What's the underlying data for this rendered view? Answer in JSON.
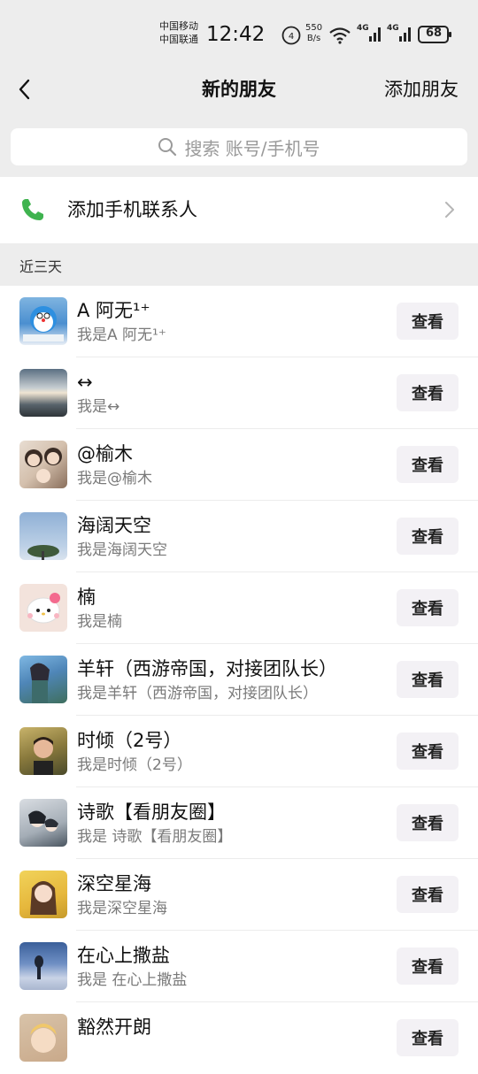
{
  "status_bar": {
    "carrier_1": "中国移动",
    "carrier_2": "中国联通",
    "time": "12:42",
    "net_speed_value": "550",
    "net_speed_unit": "B/s",
    "signal_label_1": "4G",
    "signal_label_2": "4G",
    "battery": "68"
  },
  "nav": {
    "title": "新的朋友",
    "action": "添加朋友"
  },
  "search": {
    "placeholder": "搜索 账号/手机号"
  },
  "add_contacts": {
    "label": "添加手机联系人"
  },
  "section": {
    "title": "近三天"
  },
  "requests": [
    {
      "name": "A 阿无¹⁺",
      "message": "我是A 阿无¹⁺",
      "button": "查看",
      "avatar": "doraemon-avatar"
    },
    {
      "name": "↔",
      "message": "我是↔",
      "button": "查看",
      "avatar": "sky-avatar"
    },
    {
      "name": "@榆木",
      "message": "我是@榆木",
      "button": "查看",
      "avatar": "family-avatar"
    },
    {
      "name": "海阔天空",
      "message": "我是海阔天空",
      "button": "查看",
      "avatar": "tree-avatar"
    },
    {
      "name": "楠",
      "message": "我是楠",
      "button": "查看",
      "avatar": "hello-kitty-avatar"
    },
    {
      "name": "羊轩（西游帝国，对接团队长）",
      "message": "我是羊轩（西游帝国，对接团队长）",
      "button": "查看",
      "avatar": "anime-avatar"
    },
    {
      "name": "时倾（2号）",
      "message": "我是时倾（2号）",
      "button": "查看",
      "avatar": "man-avatar"
    },
    {
      "name": " 诗歌【看朋友圈】",
      "message": "我是 诗歌【看朋友圈】",
      "button": "查看",
      "avatar": "anime-couple-avatar"
    },
    {
      "name": "深空星海",
      "message": "我是深空星海",
      "button": "查看",
      "avatar": "girl-avatar"
    },
    {
      "name": " 在心上撒盐",
      "message": "我是 在心上撒盐",
      "button": "查看",
      "avatar": "beach-avatar"
    },
    {
      "name": "豁然开朗",
      "message": "",
      "button": "查看",
      "avatar": "cartoon-avatar"
    }
  ]
}
